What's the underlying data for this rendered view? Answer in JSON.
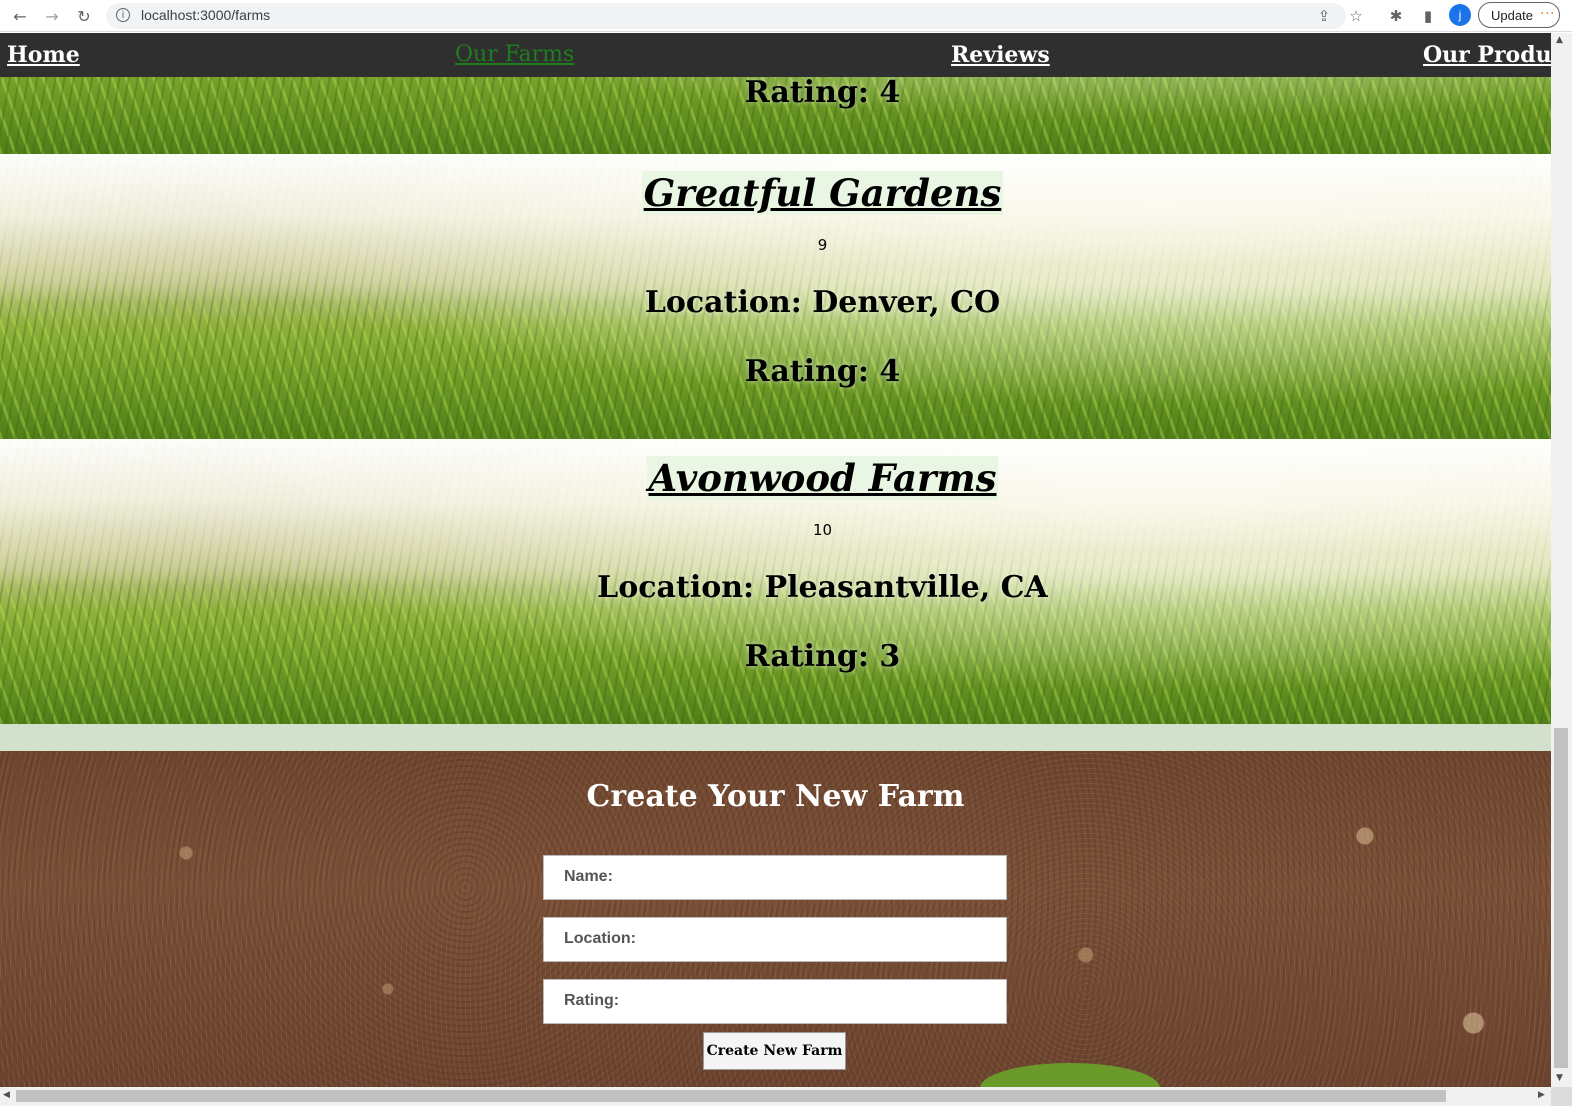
{
  "browser": {
    "url": "localhost:3000/farms",
    "update_label": "Update",
    "profile_initial": "j",
    "icons": [
      "back-icon",
      "forward-icon",
      "reload-icon",
      "info-icon",
      "share-icon",
      "star-icon",
      "extensions-icon",
      "side-panel-icon",
      "more-icon"
    ]
  },
  "nav": {
    "items": [
      {
        "label": "Home",
        "active": false
      },
      {
        "label": "Our Farms",
        "active": true
      },
      {
        "label": "Reviews",
        "active": false
      },
      {
        "label": "Our Products",
        "active": false
      }
    ],
    "active_color": "#1e7d1e"
  },
  "farms": [
    {
      "rating": "Rating: 4"
    },
    {
      "name": "Greatful Gardens",
      "id": "9",
      "location": "Location: Denver, CO",
      "rating": "Rating: 4"
    },
    {
      "name": "Avonwood Farms",
      "id": "10",
      "location": "Location: Pleasantville, CA",
      "rating": "Rating: 3"
    }
  ],
  "form": {
    "title": "Create Your New Farm",
    "name_placeholder": "Name:",
    "location_placeholder": "Location:",
    "rating_placeholder": "Rating:",
    "submit_label": "Create New Farm"
  }
}
